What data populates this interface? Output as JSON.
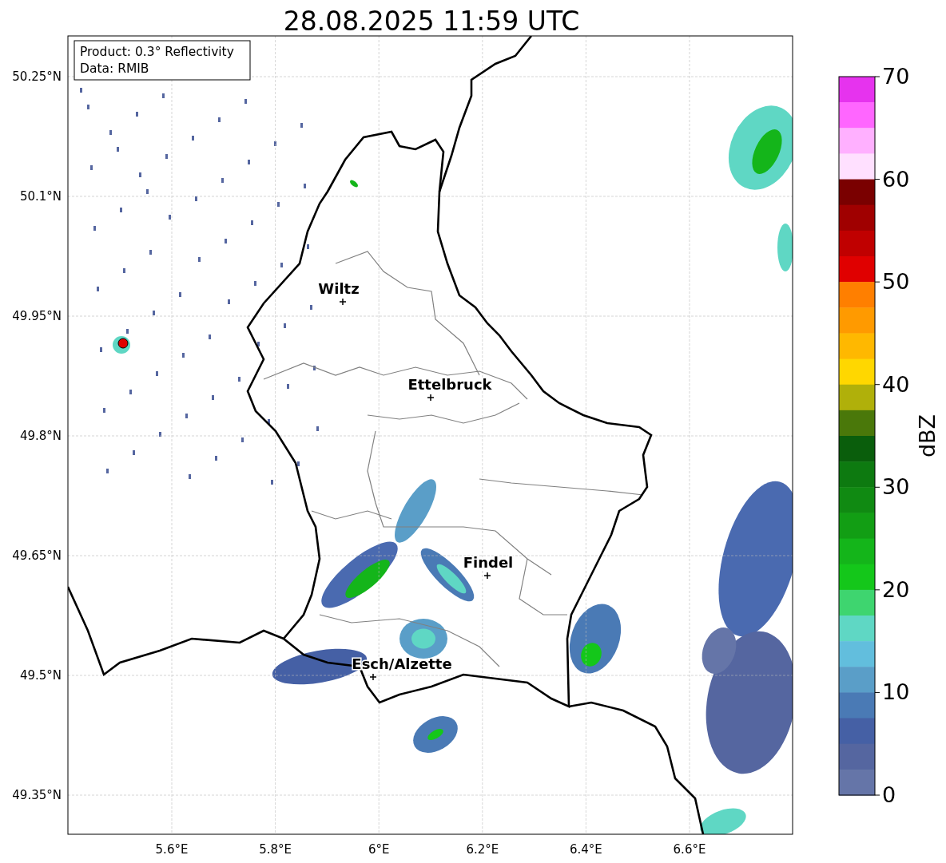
{
  "title": "28.08.2025 11:59 UTC",
  "info_box": [
    "Product: 0.3° Reflectivity",
    "Data: RMIB"
  ],
  "map": {
    "yticks": [
      "50.25°N",
      "50.1°N",
      "49.95°N",
      "49.8°N",
      "49.65°N",
      "49.5°N",
      "49.35°N"
    ],
    "xticks": [
      "5.6°E",
      "5.8°E",
      "6°E",
      "6.2°E",
      "6.4°E",
      "6.6°E"
    ],
    "cities": [
      {
        "name": "Wiltz"
      },
      {
        "name": "Ettelbruck"
      },
      {
        "name": "Findel"
      },
      {
        "name": "Esch/Alzette"
      }
    ]
  },
  "colorbar": {
    "label": "dBZ",
    "ticks": [
      "70",
      "60",
      "50",
      "40",
      "30",
      "20",
      "10",
      "0"
    ],
    "segments": [
      {
        "color": "#e633ee"
      },
      {
        "color": "#ff66ff"
      },
      {
        "color": "#ffb0ff"
      },
      {
        "color": "#ffe0ff"
      },
      {
        "color": "#7a0000"
      },
      {
        "color": "#a00000"
      },
      {
        "color": "#c00000"
      },
      {
        "color": "#e00000"
      },
      {
        "color": "#ff7f00"
      },
      {
        "color": "#ff9a00"
      },
      {
        "color": "#ffb800"
      },
      {
        "color": "#ffd700"
      },
      {
        "color": "#b0b00a"
      },
      {
        "color": "#4a780a"
      },
      {
        "color": "#0a5e0c"
      },
      {
        "color": "#0d7a10"
      },
      {
        "color": "#108a12"
      },
      {
        "color": "#129e14"
      },
      {
        "color": "#14b51a"
      },
      {
        "color": "#14c71a"
      },
      {
        "color": "#3ed56f"
      },
      {
        "color": "#5fd7c4"
      },
      {
        "color": "#62bedd"
      },
      {
        "color": "#5a9ec8"
      },
      {
        "color": "#4a7ab5"
      },
      {
        "color": "#4560a5"
      },
      {
        "color": "#5566a0"
      },
      {
        "color": "#6575a8"
      }
    ]
  }
}
